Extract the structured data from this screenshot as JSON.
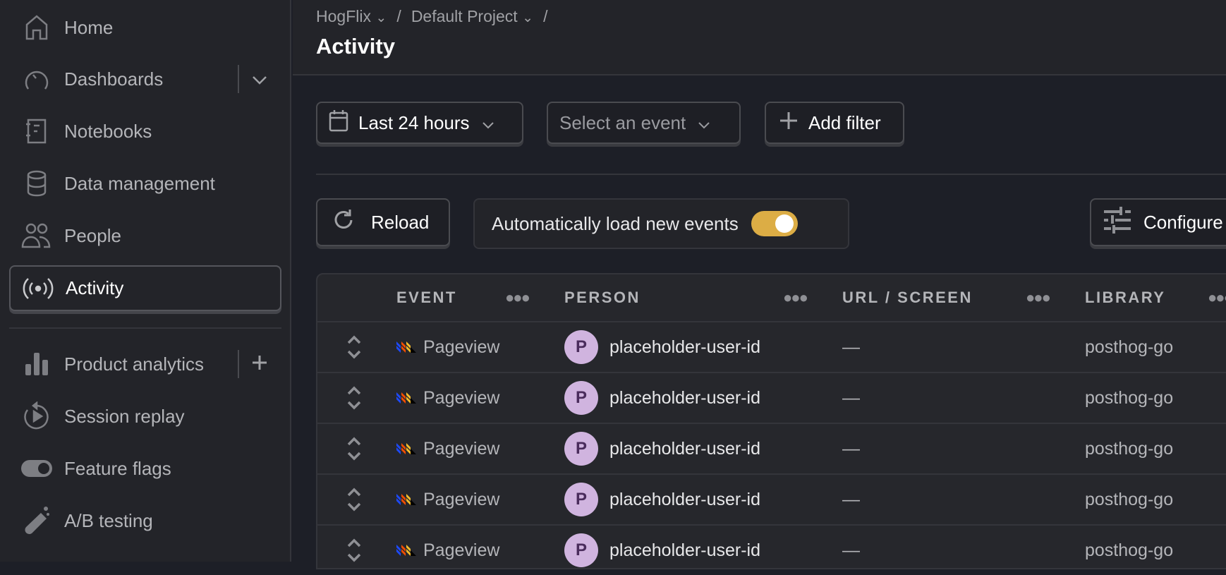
{
  "sidebar": {
    "items": [
      {
        "label": "Home",
        "icon": "home-icon"
      },
      {
        "label": "Dashboards",
        "icon": "gauge-icon"
      },
      {
        "label": "Notebooks",
        "icon": "notebook-icon"
      },
      {
        "label": "Data management",
        "icon": "database-icon"
      },
      {
        "label": "People",
        "icon": "people-icon"
      },
      {
        "label": "Activity",
        "icon": "broadcast-icon",
        "active": true
      },
      {
        "label": "Product analytics",
        "icon": "bar-chart-icon"
      },
      {
        "label": "Session replay",
        "icon": "replay-icon"
      },
      {
        "label": "Feature flags",
        "icon": "toggle-icon"
      },
      {
        "label": "A/B testing",
        "icon": "flask-icon"
      }
    ]
  },
  "header": {
    "breadcrumbs": [
      "HogFlix",
      "Default Project"
    ],
    "separator": "/",
    "title": "Activity"
  },
  "filters": {
    "date_range": "Last 24 hours",
    "event_placeholder": "Select an event",
    "add_filter": "Add filter"
  },
  "toolbar": {
    "reload": "Reload",
    "auto_load_label": "Automatically load new events",
    "auto_load_enabled": true,
    "configure": "Configure"
  },
  "colors": {
    "accent_toggle": "#dcad45",
    "avatar": "#d0b4df"
  },
  "table": {
    "columns": [
      "EVENT",
      "PERSON",
      "URL / SCREEN",
      "LIBRARY"
    ],
    "rows": [
      {
        "event": "Pageview",
        "avatar": "P",
        "person": "placeholder-user-id",
        "url": "—",
        "library": "posthog-go"
      },
      {
        "event": "Pageview",
        "avatar": "P",
        "person": "placeholder-user-id",
        "url": "—",
        "library": "posthog-go"
      },
      {
        "event": "Pageview",
        "avatar": "P",
        "person": "placeholder-user-id",
        "url": "—",
        "library": "posthog-go"
      },
      {
        "event": "Pageview",
        "avatar": "P",
        "person": "placeholder-user-id",
        "url": "—",
        "library": "posthog-go"
      },
      {
        "event": "Pageview",
        "avatar": "P",
        "person": "placeholder-user-id",
        "url": "—",
        "library": "posthog-go"
      }
    ]
  }
}
